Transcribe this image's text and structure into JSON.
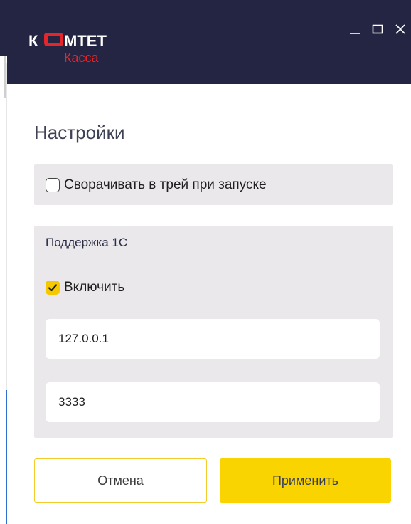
{
  "window": {
    "logo_text_top": "К МТЕТ",
    "logo_text_bottom": "Касса",
    "controls": {
      "minimize": "_",
      "maximize": "☐",
      "close": "✕"
    }
  },
  "page_title": "Настройки",
  "tray": {
    "label": "Сворачивать в трей при запуске",
    "checked": false
  },
  "support_1c": {
    "title": "Поддержка 1С",
    "enable_label": "Включить",
    "enabled": true,
    "host": "127.0.0.1",
    "port": "3333"
  },
  "buttons": {
    "cancel": "Отмена",
    "apply": "Применить"
  },
  "colors": {
    "titlebar": "#232542",
    "accent_yellow": "#f9d400",
    "panel_bg": "#eae8ea",
    "logo_red": "#e4262b"
  },
  "icons": {
    "logo": "komtet-kassa-logo",
    "check": "checkmark-icon"
  }
}
